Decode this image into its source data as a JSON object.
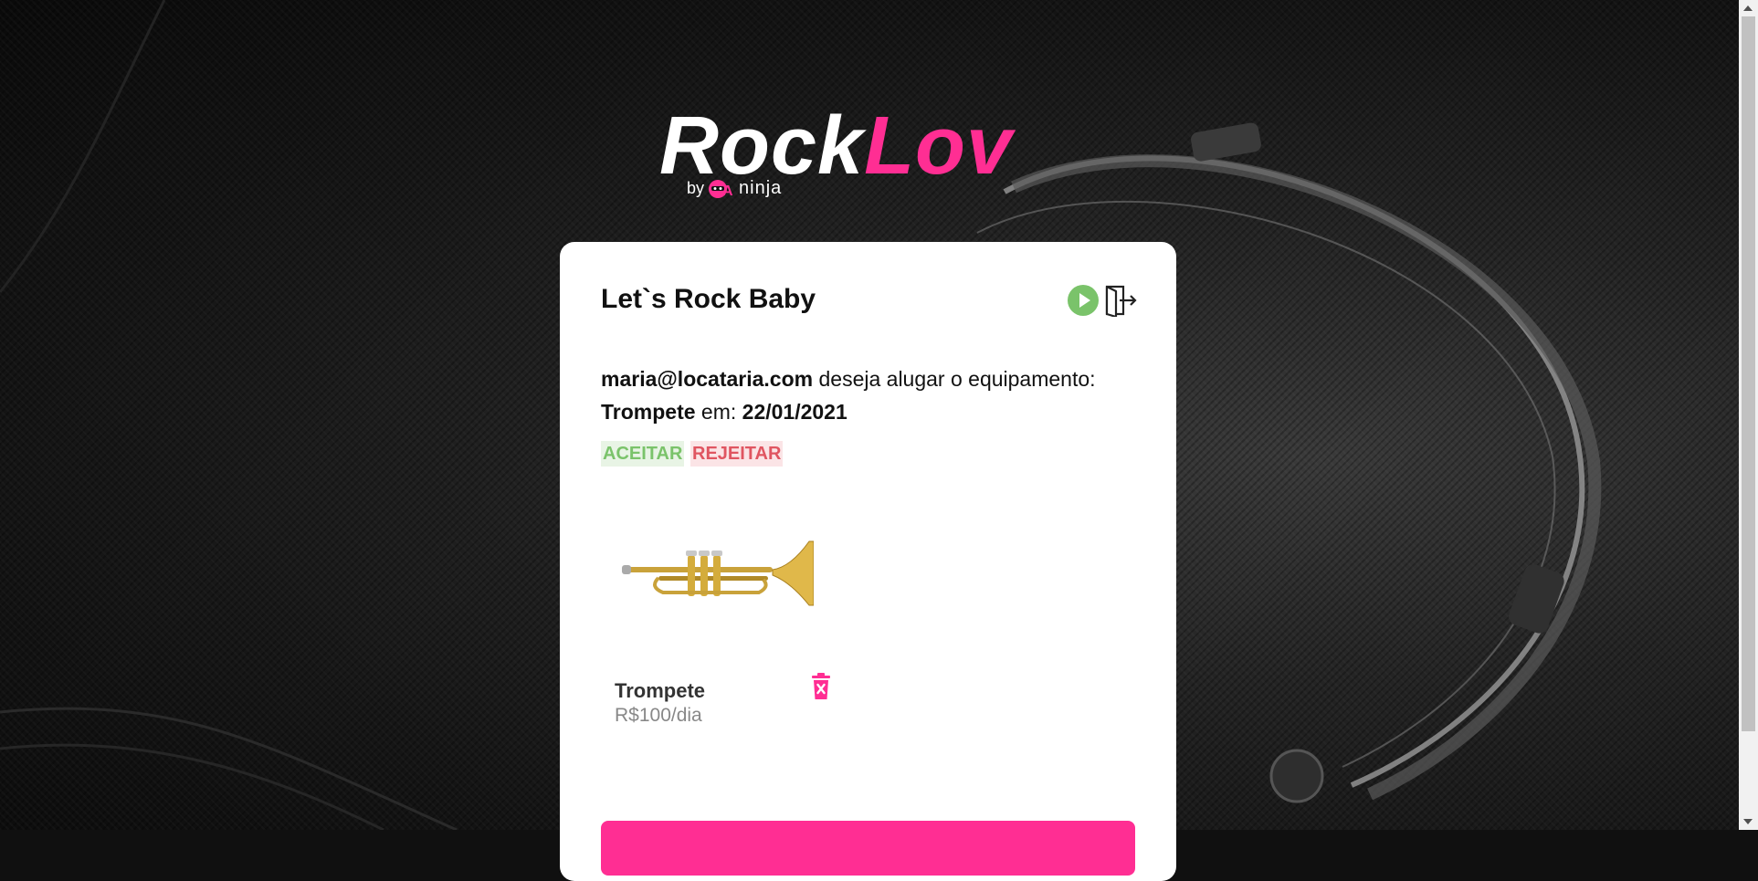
{
  "logo": {
    "rock": "Rock",
    "lov": "Lov",
    "by": "by",
    "qa": "QA",
    "ninja": "ninja"
  },
  "card": {
    "title": "Let`s Rock Baby",
    "icons": {
      "play": "play-circle-icon",
      "exit": "exit-door-icon"
    },
    "request": {
      "email": "maria@locataria.com",
      "text": " deseja alugar o equipamento:",
      "equipment": "Trompete",
      "date_prefix": " em: ",
      "date": "22/01/2021"
    },
    "actions": {
      "accept": "ACEITAR",
      "reject": "REJEITAR"
    },
    "equipment_item": {
      "name": "Trompete",
      "price": "R$100/dia",
      "icon": "trash-icon"
    }
  },
  "colors": {
    "accent": "#ff2e93",
    "accept": "#7ac36a",
    "reject": "#e05561"
  }
}
